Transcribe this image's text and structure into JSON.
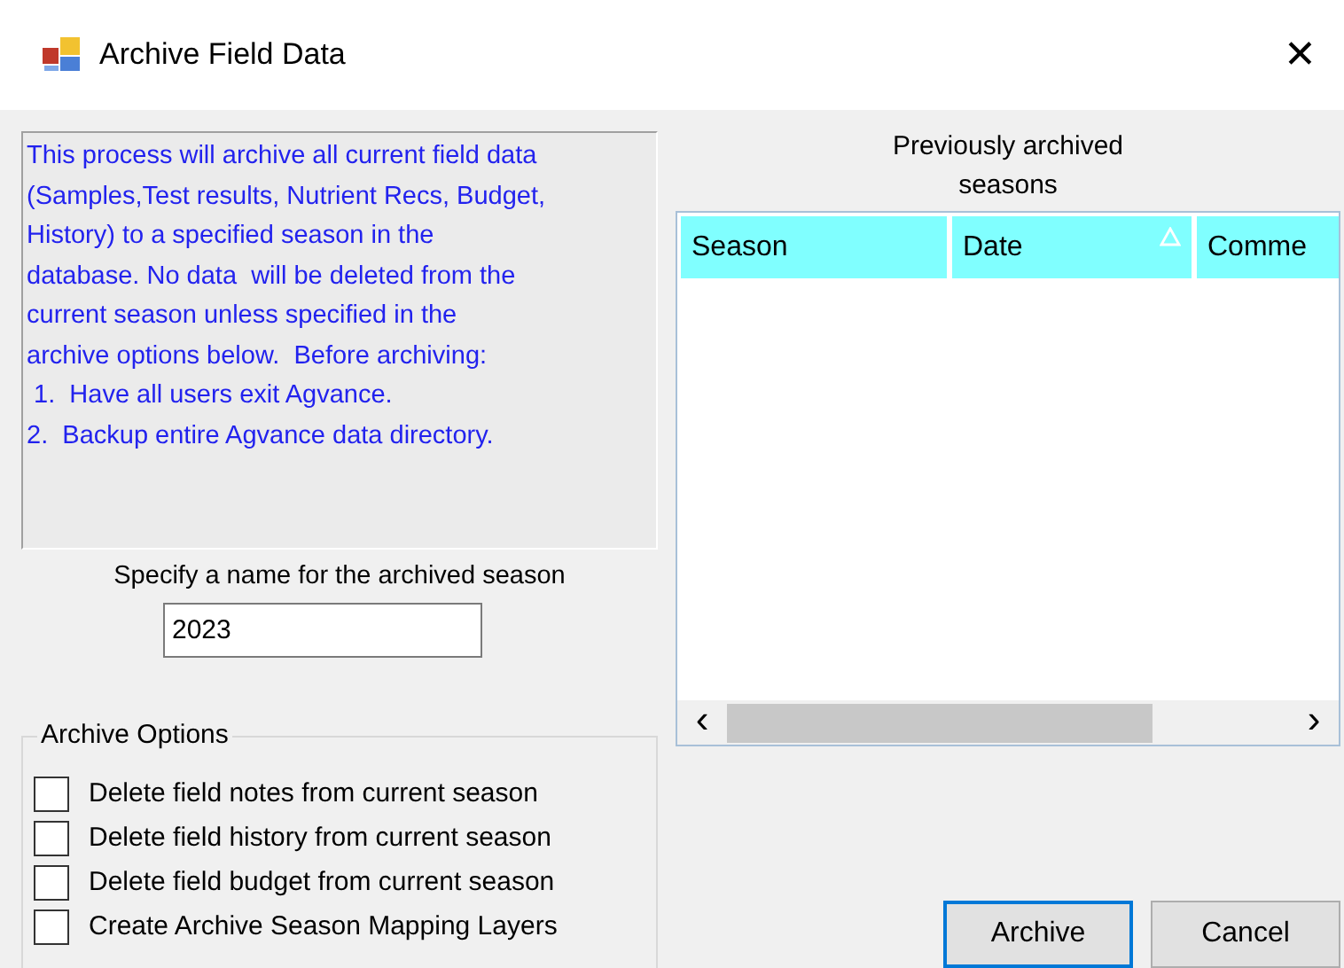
{
  "window": {
    "title": "Archive Field Data",
    "close": "✕"
  },
  "description": "This process will archive all current field data\n(Samples,Test results, Nutrient Recs, Budget,\nHistory) to a specified season in the\ndatabase. No data  will be deleted from the\ncurrent season unless specified in the\narchive options below.  Before archiving:\n 1.  Have all users exit Agvance.\n2.  Backup entire Agvance data directory.",
  "season_name": {
    "label": "Specify a name for the archived season",
    "value": "2023"
  },
  "archive_options": {
    "title": "Archive Options",
    "options": [
      {
        "label": "Delete field notes from current season",
        "checked": false
      },
      {
        "label": "Delete field history from current season",
        "checked": false
      },
      {
        "label": "Delete field budget from current season",
        "checked": false
      },
      {
        "label": "Create Archive Season Mapping Layers",
        "checked": false
      }
    ]
  },
  "archived_seasons": {
    "title": "Previously archived\nseasons",
    "columns": [
      {
        "label": "Season",
        "sorted": false
      },
      {
        "label": "Date",
        "sorted": true
      },
      {
        "label": "Comme",
        "sorted": false
      }
    ],
    "scroll_left": "‹",
    "scroll_right": "›"
  },
  "buttons": [
    {
      "label": "Archive",
      "default": true
    },
    {
      "label": "Cancel",
      "default": false
    }
  ]
}
